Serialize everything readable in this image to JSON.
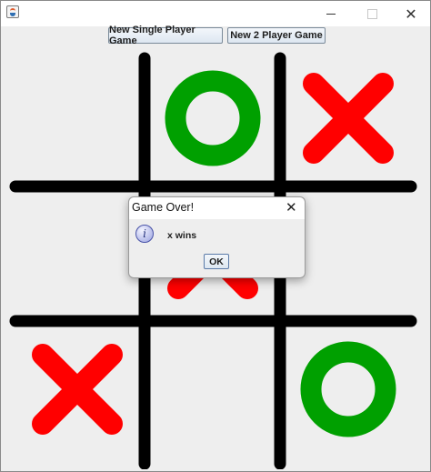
{
  "window": {
    "title": "",
    "controls": {
      "minimize": "minimize-icon",
      "maximize": "maximize-icon",
      "close": "close-icon"
    }
  },
  "toolbar": {
    "single_player_label": "New Single Player Game",
    "two_player_label": "New 2 Player Game"
  },
  "board": {
    "cells": [
      "",
      "O",
      "X",
      "",
      "X",
      "",
      "X",
      "",
      "O"
    ],
    "colors": {
      "x": "#ff0000",
      "o": "#00a000",
      "grid": "#000000",
      "background": "#eeeeee"
    }
  },
  "dialog": {
    "title": "Game Over!",
    "message": "x wins",
    "ok_label": "OK",
    "icon": "info-icon"
  }
}
